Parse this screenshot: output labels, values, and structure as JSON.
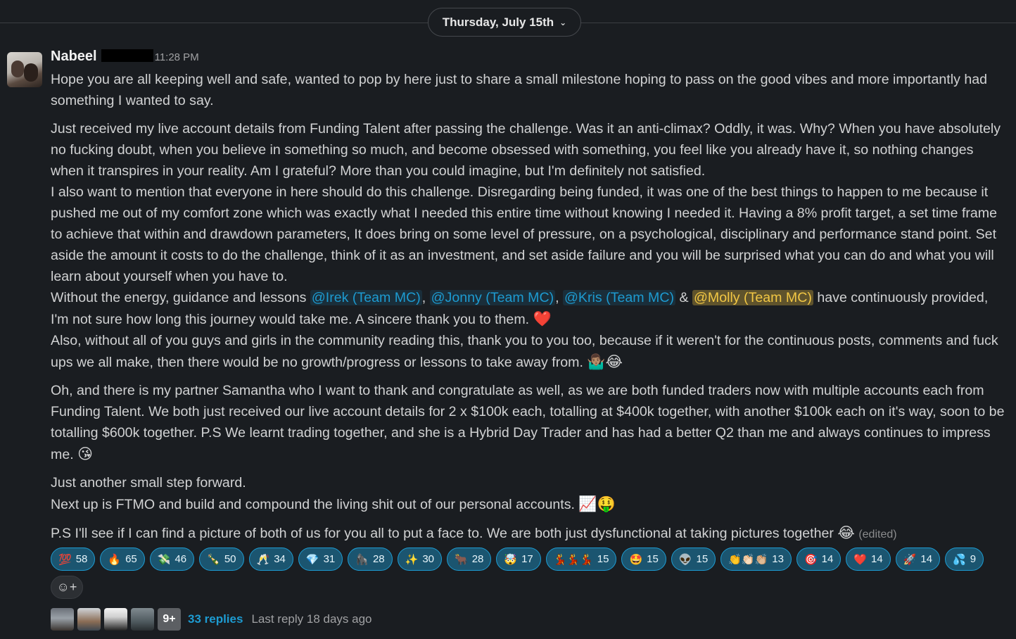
{
  "date_divider": {
    "label": "Thursday, July 15th",
    "chevron_icon": "chevron-down-icon"
  },
  "message": {
    "sender": "Nabeel",
    "timestamp": "11:28 PM",
    "p1": "Hope you are all keeping well and safe, wanted to pop by here just to share a small milestone hoping to pass on the good vibes and more importantly had something I wanted to say.",
    "p2a": "Just received my live account details from Funding Talent after passing the challenge. Was it an anti-climax? Oddly, it was. Why? When you have absolutely no fucking doubt, when you believe in something so much, and become obsessed with something, you feel like you already have it, so nothing changes when it transpires in your reality. Am I grateful? More than you could imagine, but I'm definitely not satisfied.",
    "p2b": "I also want to mention that everyone in here should do this challenge. Disregarding being funded, it was one of the best things to happen to me because it pushed me out of my comfort zone which was exactly what I needed this entire time without knowing I needed it. Having a 8% profit target, a set time frame to achieve that within and drawdown parameters, It does bring on some level of pressure, on a psychological, disciplinary and performance stand point. Set aside the amount it costs to do the challenge, think of it as an investment, and set aside failure and you will be surprised what you can do and what you will learn about yourself when you have to.",
    "p2c_pre": "Without the energy, guidance and lessons ",
    "mention1": "@Irek (Team MC)",
    "sep1": ", ",
    "mention2": "@Jonny (Team MC)",
    "sep2": ", ",
    "mention3": "@Kris (Team MC)",
    "sep3": " & ",
    "mention4": "@Molly (Team MC)",
    "p2c_post": " have continuously provided, I'm not sure how long this journey would take me. A sincere thank you to them. ",
    "p2c_emoji": "❤️",
    "p2d": "Also, without all of you guys and girls in the community reading this, thank you to you too, because if it weren't for the continuous posts, comments and fuck ups we all make, then there would be no growth/progress or lessons to take away from. ",
    "p2d_emoji": "🤷🏽‍♂️😂",
    "p3": "Oh, and there is my partner Samantha who I want to thank and congratulate as well, as we are both funded traders now with multiple accounts each from Funding Talent. We both just received our live account details for 2 x $100k each, totalling at $400k together, with another $100k each on it's way, soon to be totalling $600k together. P.S We learnt trading together, and she is a Hybrid Day Trader and has had a better Q2 than me and always continues to impress me. ",
    "p3_emoji": "😘",
    "p4a": "Just another small step forward.",
    "p4b": "Next up is FTMO and build and compound the living shit out of our personal accounts. ",
    "p4b_emoji": "📈🤑",
    "p5": "P.S I'll see if I can find a picture of both of us for you all to put a face to. We are both just dysfunctional at taking pictures together ",
    "p5_emoji": "😂",
    "edited": "(edited)"
  },
  "reactions": [
    {
      "emoji": "💯",
      "count": "58"
    },
    {
      "emoji": "🔥",
      "count": "65"
    },
    {
      "emoji": "💸",
      "count": "46"
    },
    {
      "emoji": "🍾",
      "count": "50"
    },
    {
      "emoji": "🥂",
      "count": "34"
    },
    {
      "emoji": "💎",
      "count": "31"
    },
    {
      "emoji": "🦍",
      "count": "28"
    },
    {
      "emoji": "✨",
      "count": "30"
    },
    {
      "emoji": "🐂",
      "count": "28"
    },
    {
      "emoji": "🤯",
      "count": "17"
    },
    {
      "emoji": "💃💃💃",
      "count": "15"
    },
    {
      "emoji": "🤩",
      "count": "15"
    },
    {
      "emoji": "👽",
      "count": "15"
    },
    {
      "emoji": "👏👏🏻👏🏼",
      "count": "13"
    },
    {
      "emoji": "🎯",
      "count": "14"
    },
    {
      "emoji": "❤️",
      "count": "14"
    },
    {
      "emoji": "🚀",
      "count": "14"
    },
    {
      "emoji": "💦",
      "count": "9"
    }
  ],
  "add_reaction_icon": "add-reaction-icon",
  "add_reaction_glyph": "☺+",
  "thread": {
    "more_avatars": "9+",
    "reply_count": "33 replies",
    "last_reply": "Last reply 18 days ago"
  }
}
